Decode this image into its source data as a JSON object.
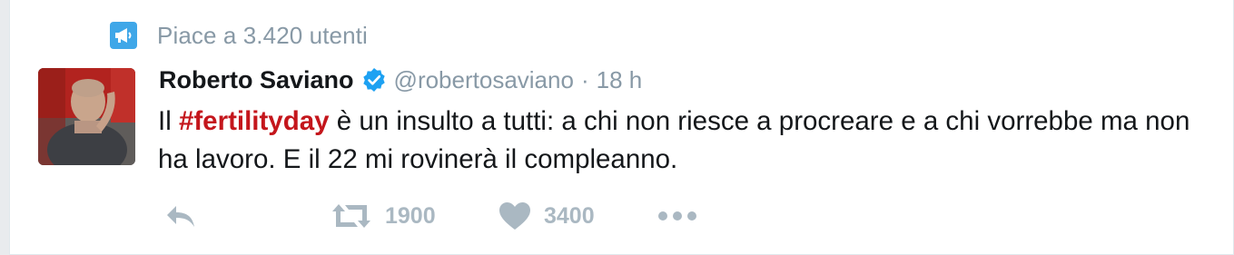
{
  "promo": {
    "icon": "megaphone-icon",
    "text": "Piace a 3.420 utenti"
  },
  "tweet": {
    "author": {
      "name": "Roberto Saviano",
      "verified": true,
      "handle": "@robertosaviano",
      "separator": "·",
      "time": "18 h",
      "avatar": "avatar"
    },
    "text": {
      "prefix": "Il ",
      "hashtag": "#fertilityday",
      "suffix": " è un insulto a tutti: a chi non riesce a procreare e a chi vorrebbe ma non ha lavoro. E il 22 mi rovinerà il compleanno."
    },
    "actions": {
      "reply": {
        "icon": "reply-icon"
      },
      "retweet": {
        "icon": "retweet-icon",
        "count": "1900"
      },
      "like": {
        "icon": "heart-icon",
        "count": "3400"
      },
      "more": {
        "icon": "more-icon"
      }
    }
  },
  "colors": {
    "hashtag": "#c4161c",
    "muted": "#8899a6",
    "action": "#aab8c2",
    "verified": "#1da1f2",
    "promo_icon_bg": "#3fa7e8"
  }
}
